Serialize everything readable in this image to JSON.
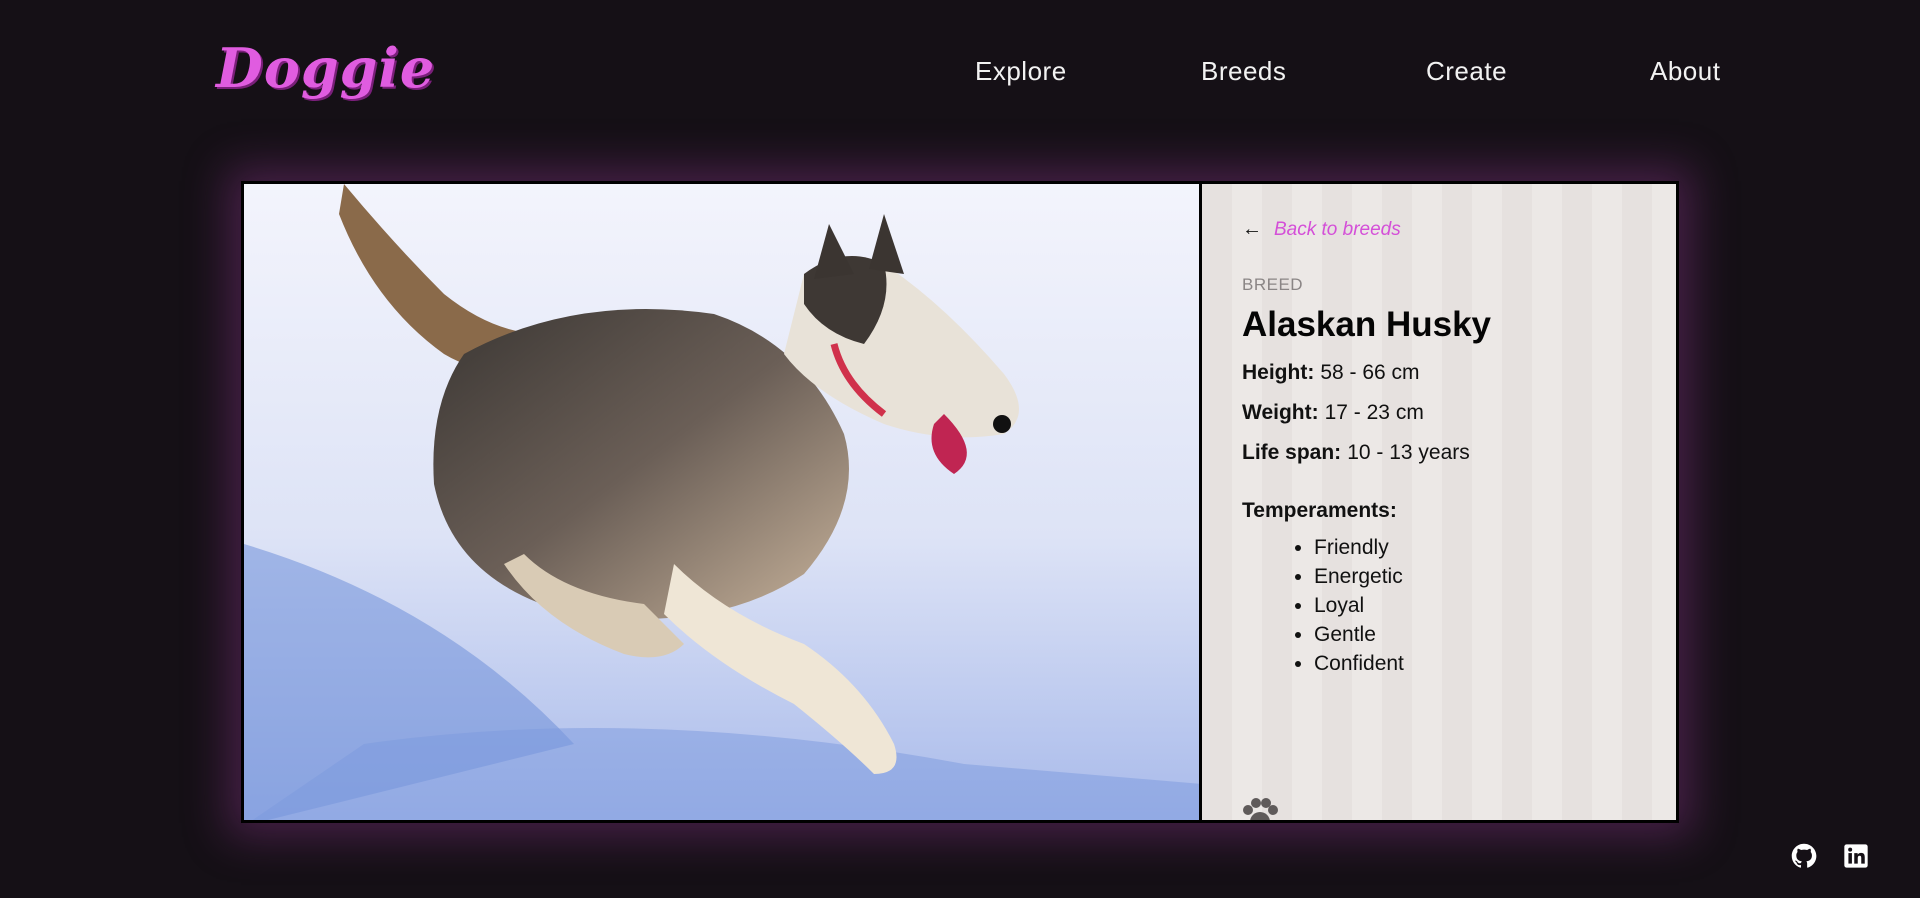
{
  "brand": {
    "logo": "Doggie"
  },
  "nav": [
    {
      "label": "Explore"
    },
    {
      "label": "Breeds"
    },
    {
      "label": "Create"
    },
    {
      "label": "About"
    }
  ],
  "detail": {
    "back_label": "Back to breeds",
    "breed_tag": "BREED",
    "breed_name": "Alaskan Husky",
    "height_label": "Height:",
    "height_value": "58 - 66 cm",
    "weight_label": "Weight:",
    "weight_value": "17 - 23 cm",
    "lifespan_label": "Life span:",
    "lifespan_value": "10 - 13 years",
    "temperaments_label": "Temperaments:",
    "temperaments": [
      "Friendly",
      "Energetic",
      "Loyal",
      "Gentle",
      "Confident"
    ]
  },
  "icons": {
    "back": "arrow-left-icon",
    "paw": "paw-icon",
    "github": "github-icon",
    "linkedin": "linkedin-icon"
  },
  "colors": {
    "accent": "#e05ce0",
    "link": "#d44fd8",
    "background": "#151016",
    "panel": "#e6e1df"
  }
}
